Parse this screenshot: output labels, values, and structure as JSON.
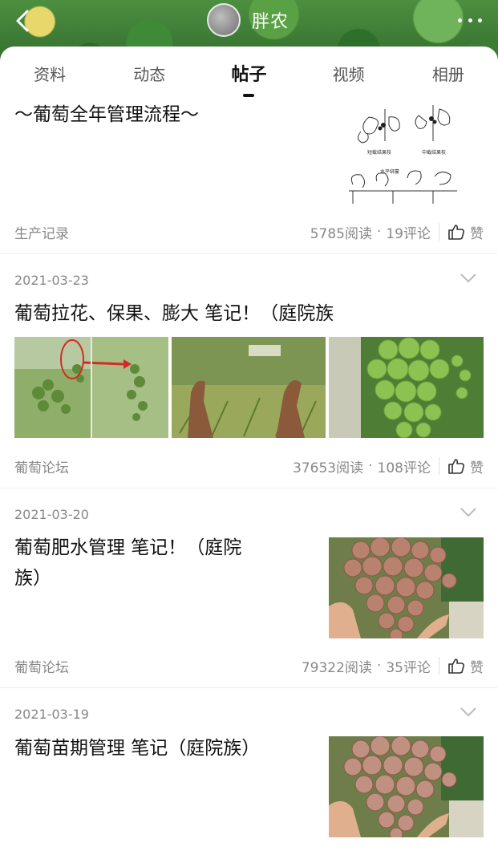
{
  "header": {
    "name": "胖农",
    "back_icon": "back-arrow-icon",
    "more_icon": "more-dots-icon"
  },
  "tabs": [
    {
      "label": "资料"
    },
    {
      "label": "动态"
    },
    {
      "label": "帖子",
      "active": true
    },
    {
      "label": "视频"
    },
    {
      "label": "相册"
    }
  ],
  "posts": [
    {
      "title": "～葡萄全年管理流程～",
      "source": "生产记录",
      "reads": "5785阅读",
      "comments": "19评论",
      "like": "赞",
      "thumb_labels": [
        "短截结果枝",
        "中截结果枝",
        "水平绑蔓"
      ]
    },
    {
      "date": "2021-03-23",
      "title": "葡萄拉花、保果、膨大  笔记！（庭院族",
      "source": "葡萄论坛",
      "reads": "37653阅读",
      "comments": "108评论",
      "like": "赞"
    },
    {
      "date": "2021-03-20",
      "title_line1": "葡萄肥水管理  笔记！（庭院",
      "title_line2": "族）",
      "source": "葡萄论坛",
      "reads": "79322阅读",
      "comments": "35评论",
      "like": "赞"
    },
    {
      "date": "2021-03-19",
      "title": "葡萄苗期管理 笔记（庭院族）"
    }
  ],
  "separator": "·",
  "colors": {
    "accent": "#111111",
    "muted": "#888888",
    "divider": "#eeeeee"
  }
}
